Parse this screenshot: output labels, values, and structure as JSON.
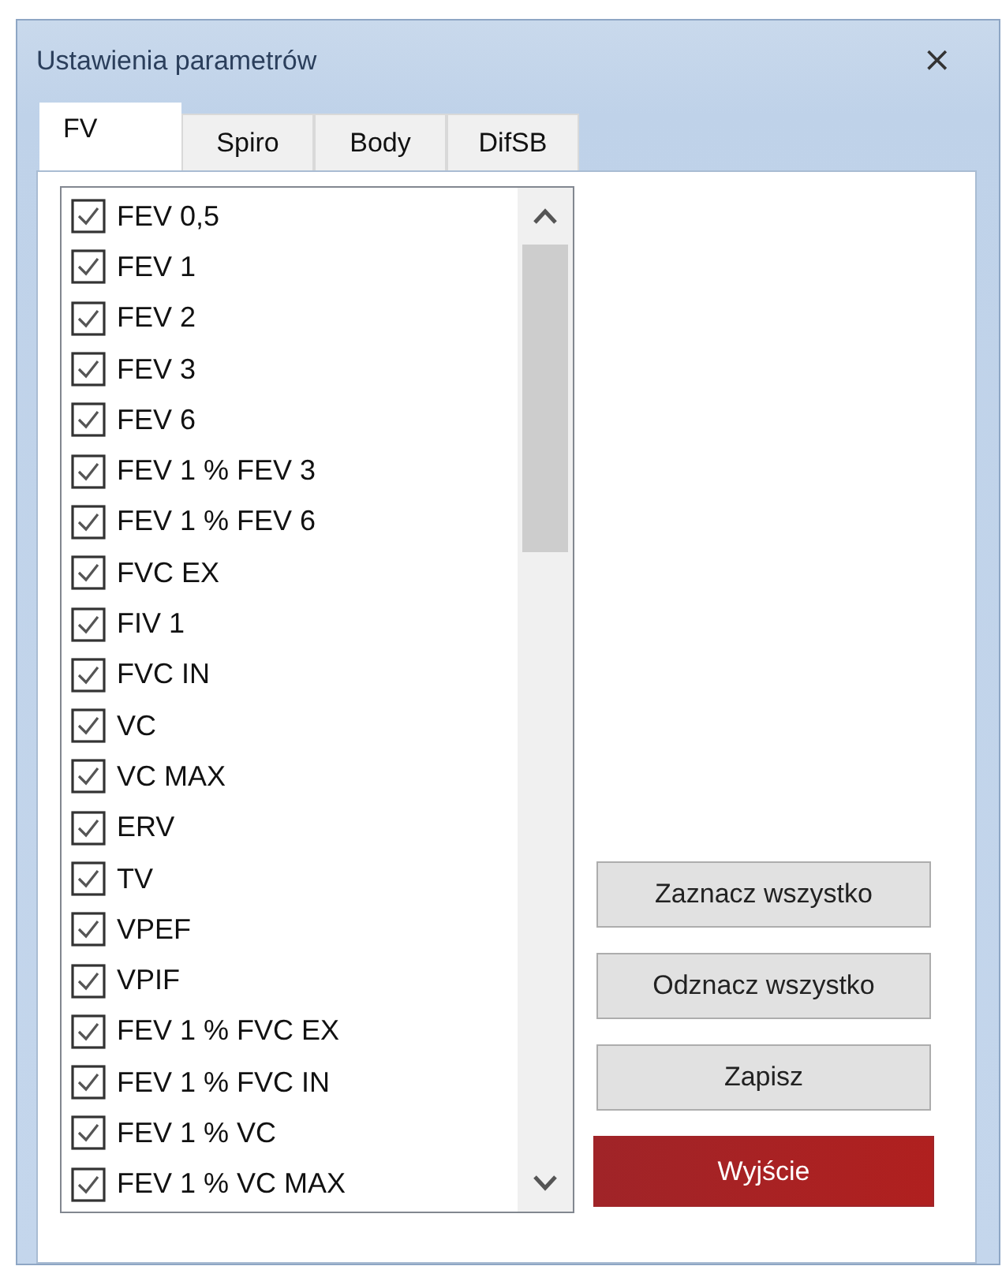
{
  "window": {
    "title": "Ustawienia parametrów",
    "close": "⨯"
  },
  "tabs": [
    {
      "label": "FV",
      "selected": true
    },
    {
      "label": "Spiro",
      "selected": false
    },
    {
      "label": "Body",
      "selected": false
    },
    {
      "label": "DifSB",
      "selected": false
    }
  ],
  "list": {
    "items": [
      {
        "label": "FEV 0,5",
        "checked": true
      },
      {
        "label": "FEV 1",
        "checked": true
      },
      {
        "label": "FEV 2",
        "checked": true
      },
      {
        "label": "FEV 3",
        "checked": true
      },
      {
        "label": "FEV 6",
        "checked": true
      },
      {
        "label": "FEV 1 % FEV 3",
        "checked": true
      },
      {
        "label": "FEV 1 % FEV 6",
        "checked": true
      },
      {
        "label": "FVC EX",
        "checked": true
      },
      {
        "label": "FIV 1",
        "checked": true
      },
      {
        "label": "FVC IN",
        "checked": true
      },
      {
        "label": "VC",
        "checked": true
      },
      {
        "label": "VC MAX",
        "checked": true
      },
      {
        "label": "ERV",
        "checked": true
      },
      {
        "label": "TV",
        "checked": true
      },
      {
        "label": "VPEF",
        "checked": true
      },
      {
        "label": "VPIF",
        "checked": true
      },
      {
        "label": "FEV 1 % FVC EX",
        "checked": true
      },
      {
        "label": "FEV 1 % FVC IN",
        "checked": true
      },
      {
        "label": "FEV 1 % VC",
        "checked": true
      },
      {
        "label": "FEV 1 % VC MAX",
        "checked": true
      }
    ]
  },
  "buttons": [
    {
      "label": "Zaznacz wszystko",
      "kind": "normal"
    },
    {
      "label": "Odznacz wszystko",
      "kind": "normal"
    },
    {
      "label": "Zapisz",
      "kind": "normal"
    },
    {
      "label": "Wyjście",
      "kind": "danger"
    }
  ]
}
